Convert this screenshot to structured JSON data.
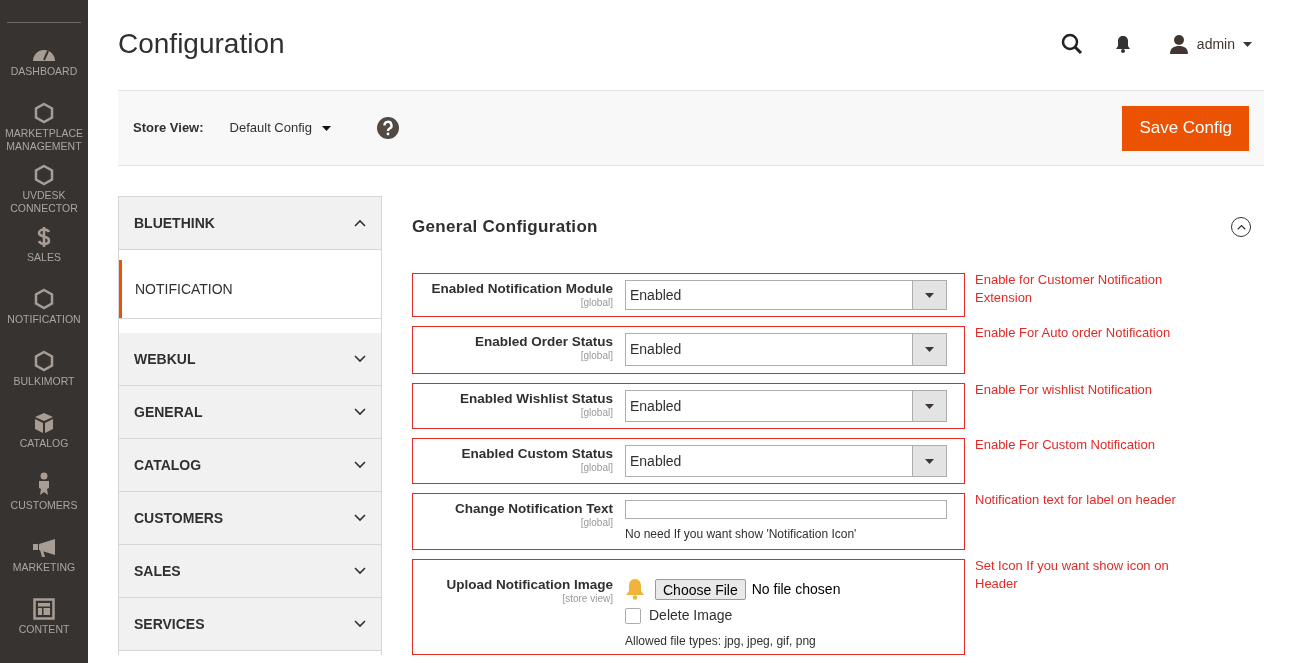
{
  "nav": [
    {
      "kind": "gauge",
      "label": "DASHBOARD"
    },
    {
      "kind": "hexagon",
      "label": "MARKETPLACE MANAGEMENT"
    },
    {
      "kind": "hexagon",
      "label": "UVDESK CONNECTOR"
    },
    {
      "kind": "dollar",
      "label": "SALES"
    },
    {
      "kind": "hexagon",
      "label": "NOTIFICATION"
    },
    {
      "kind": "hexagon",
      "label": "BULKIMORT"
    },
    {
      "kind": "box",
      "label": "CATALOG"
    },
    {
      "kind": "person",
      "label": "CUSTOMERS"
    },
    {
      "kind": "megaphone",
      "label": "MARKETING"
    },
    {
      "kind": "layout",
      "label": "CONTENT"
    }
  ],
  "header": {
    "title": "Configuration",
    "user": "admin"
  },
  "store_bar": {
    "label": "Store View:",
    "value": "Default Config",
    "button": "Save Config"
  },
  "sections": [
    {
      "label": "BLUETHINK",
      "expanded": true,
      "children": [
        {
          "label": "NOTIFICATION",
          "selected": true
        }
      ]
    },
    {
      "label": "WEBKUL",
      "expanded": false
    },
    {
      "label": "GENERAL",
      "expanded": false
    },
    {
      "label": "CATALOG",
      "expanded": false
    },
    {
      "label": "CUSTOMERS",
      "expanded": false
    },
    {
      "label": "SALES",
      "expanded": false
    },
    {
      "label": "SERVICES",
      "expanded": false
    }
  ],
  "group": {
    "title": "General Configuration",
    "expanded": true,
    "fields": [
      {
        "kind": "select",
        "label": "Enabled Notification Module",
        "scope": "[global]",
        "value": "Enabled",
        "annotation": "Enable for Customer Notification Extension"
      },
      {
        "kind": "select",
        "label": "Enabled Order Status",
        "scope": "[global]",
        "value": "Enabled",
        "annotation": "Enable For Auto order Notification"
      },
      {
        "kind": "select",
        "label": "Enabled Wishlist Status",
        "scope": "[global]",
        "value": "Enabled",
        "annotation": "Enable For wishlist Notification"
      },
      {
        "kind": "select",
        "label": "Enabled Custom Status",
        "scope": "[global]",
        "value": "Enabled",
        "annotation": "Enable For Custom Notification"
      },
      {
        "kind": "text",
        "label": "Change Notification Text",
        "scope": "[global]",
        "note": "No need If you want show 'Notification Icon'",
        "annotation": "Notification text for label on header"
      },
      {
        "kind": "file",
        "label": "Upload Notification Image",
        "scope": "[store view]",
        "button": "Choose File",
        "file_status": "No file chosen",
        "delete_label": "Delete Image",
        "delete_checked": false,
        "note": "Allowed file types: jpg, jpeg, gif, png",
        "annotation": "Set Icon If you want show icon on Header"
      }
    ]
  }
}
